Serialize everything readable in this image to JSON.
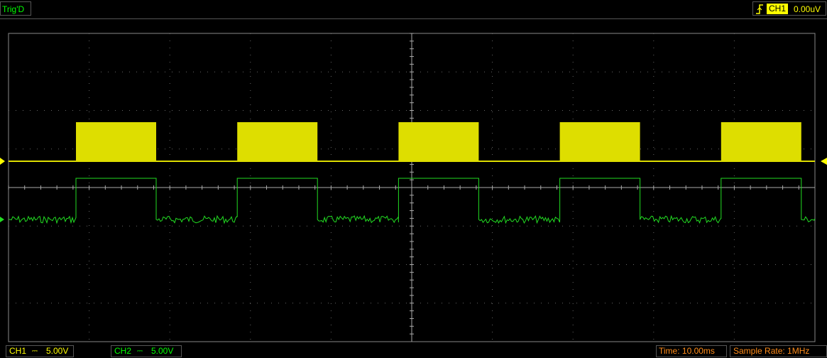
{
  "header": {
    "trig_status": "Trig'D",
    "trigger_channel": "CH1",
    "trigger_level": "0.00uV",
    "trigger_edge_icon": "rising-edge-icon"
  },
  "channels": [
    {
      "name": "CH1",
      "coupling": "DC",
      "scale": "5.00V",
      "color": "#ffff00"
    },
    {
      "name": "CH2",
      "coupling": "DC",
      "scale": "5.00V",
      "color": "#00ff00"
    }
  ],
  "footer": {
    "time": "Time: 10.00ms",
    "sample_rate": "Sample Rate: 1MHz"
  },
  "colors": {
    "ch1": "#dede00",
    "ch2": "#22dd22",
    "grid": "#bbbbbb",
    "border": "#ffffff",
    "trigger_marker": "#ffff00",
    "status_text": "#00ff00",
    "footer_text": "#ff8c1a"
  }
}
